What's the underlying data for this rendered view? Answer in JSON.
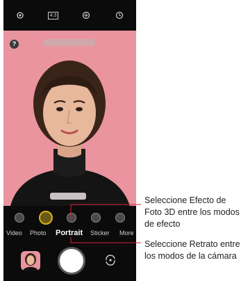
{
  "top_icons": [
    "settings-icon",
    "aspect-ratio-icon",
    "filter-icon",
    "timer-icon"
  ],
  "aspect_label": "4:3",
  "help_label": "?",
  "modes": [
    {
      "label": "Video"
    },
    {
      "label": "Photo"
    },
    {
      "label": "Portrait",
      "active": true
    },
    {
      "label": "Sticker"
    },
    {
      "label": "More"
    }
  ],
  "callouts": [
    {
      "prefix": "Seleccione ",
      "emphasis": "Efecto de Foto 3D",
      "suffix": " entre los modos de efecto"
    },
    {
      "prefix": "Seleccione ",
      "emphasis": "Retrato",
      "suffix": " entre los modos de la cámara"
    }
  ],
  "colors": {
    "accent": "#d8b218",
    "callout_line": "#d9203b",
    "background": "#e9949e"
  }
}
